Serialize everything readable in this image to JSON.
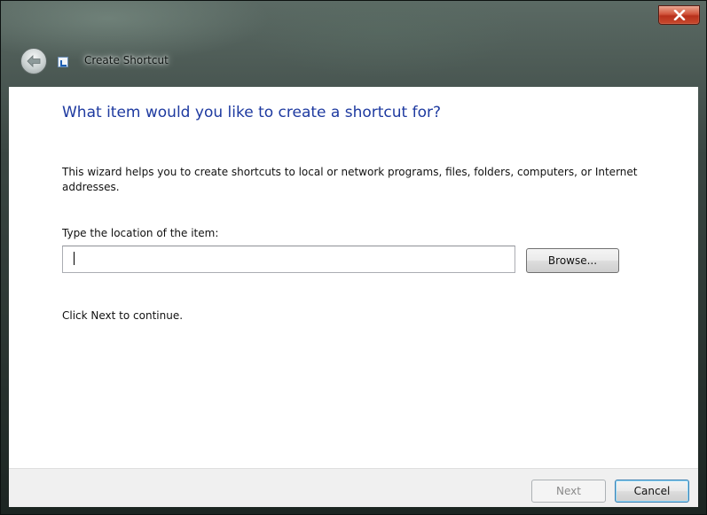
{
  "window": {
    "title": "Create Shortcut",
    "close_label": "X"
  },
  "wizard": {
    "heading": "What item would you like to create a shortcut for?",
    "description": "This wizard helps you to create shortcuts to local or network programs, files, folders, computers, or Internet addresses.",
    "location_label": "Type the location of the item:",
    "location_value": "",
    "browse_label": "Browse...",
    "hint": "Click Next to continue."
  },
  "footer": {
    "next_label": "Next",
    "cancel_label": "Cancel"
  },
  "icons": {
    "back": "back-arrow-icon",
    "app": "shortcut-icon",
    "close": "close-icon"
  },
  "colors": {
    "heading": "#1e3aa0",
    "close_button": "#c84a2e",
    "content_bg": "#ffffff",
    "footer_bg": "#f0f0f0"
  }
}
